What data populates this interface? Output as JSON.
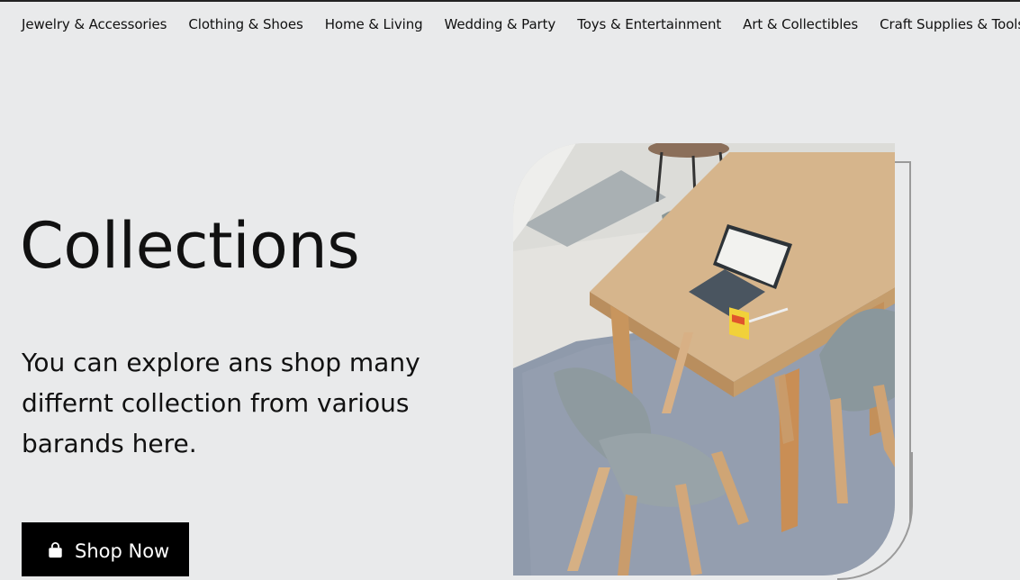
{
  "nav": {
    "items": [
      "Jewelry & Accessories",
      "Clothing & Shoes",
      "Home & Living",
      "Wedding & Party",
      "Toys & Entertainment",
      "Art & Collectibles",
      "Craft Supplies & Tools"
    ]
  },
  "hero": {
    "title": "Collections",
    "description": "You can explore ans shop many differnt collection from various barands here.",
    "button_label": "Shop Now",
    "button_icon": "shopping-bag-icon"
  }
}
